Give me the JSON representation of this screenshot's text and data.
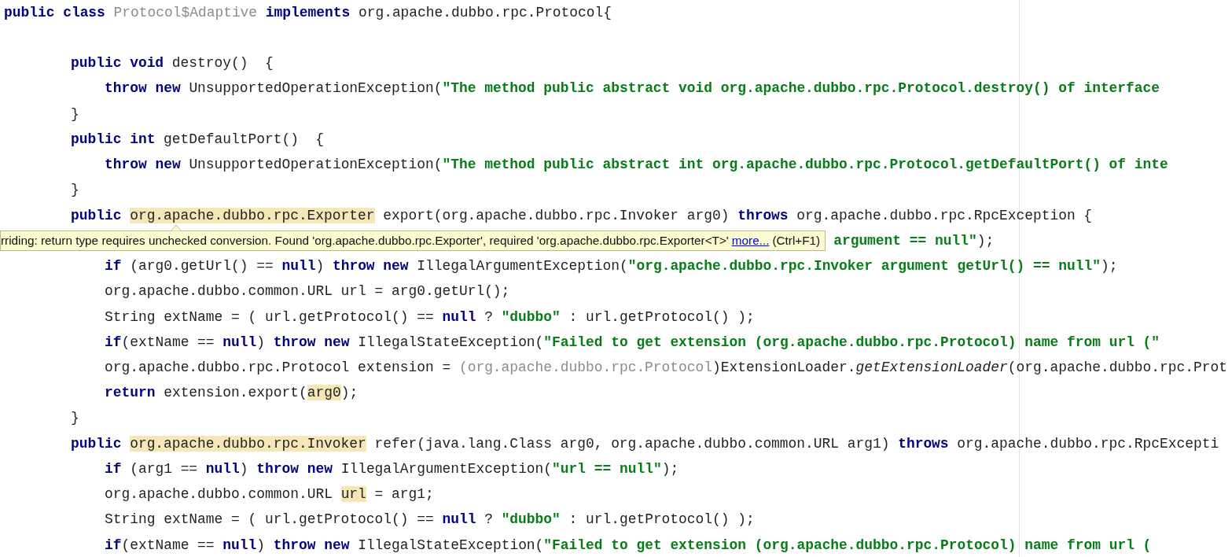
{
  "editor": {
    "lines": [
      {
        "segments": [
          {
            "kind": "keyword",
            "text": "public class "
          },
          {
            "kind": "muted",
            "text": "Protocol$Adaptive"
          },
          {
            "kind": "keyword",
            "text": " implements"
          },
          {
            "kind": "plain",
            "text": " org.apache.dubbo.rpc.Protocol{"
          }
        ],
        "children": [
          {
            "segments": [
              {
                "kind": "keyword",
                "text": "public void"
              },
              {
                "kind": "plain",
                "text": " destroy()  {"
              }
            ],
            "children": [
              {
                "segments": [
                  {
                    "kind": "keyword",
                    "text": "throw new"
                  },
                  {
                    "kind": "plain",
                    "text": " UnsupportedOperationException("
                  },
                  {
                    "kind": "string",
                    "text": "\"The method public abstract void org.apache.dubbo.rpc.Protocol.destroy() of interface"
                  }
                ]
              }
            ]
          },
          {
            "segments": [
              {
                "kind": "plain",
                "text": "}"
              }
            ]
          },
          {
            "segments": [
              {
                "kind": "keyword",
                "text": "public int"
              },
              {
                "kind": "plain",
                "text": " getDefaultPort()  {"
              }
            ],
            "children": [
              {
                "segments": [
                  {
                    "kind": "keyword",
                    "text": "throw new"
                  },
                  {
                    "kind": "plain",
                    "text": " UnsupportedOperationException("
                  },
                  {
                    "kind": "string",
                    "text": "\"The method public abstract int org.apache.dubbo.rpc.Protocol.getDefaultPort() of inte"
                  }
                ]
              }
            ]
          },
          {
            "segments": [
              {
                "kind": "plain",
                "text": "}"
              }
            ]
          },
          {
            "segments": [
              {
                "kind": "keyword",
                "text": "public "
              },
              {
                "kind": "plain",
                "text": "org.apache.dubbo.rpc.Exporter",
                "highlight": true
              },
              {
                "kind": "plain",
                "text": " export(org.apache.dubbo.rpc.Invoker arg0) "
              },
              {
                "kind": "keyword",
                "text": "throws"
              },
              {
                "kind": "plain",
                "text": " org.apache.dubbo.rpc.RpcException {"
              }
            ],
            "children": [
              {
                "tooltip": {
                  "text": "rriding: return type requires unchecked conversion. Found 'org.apache.dubbo.rpc.Exporter', required 'org.apache.dubbo.rpc.Exporter<T>'",
                  "link": "more...",
                  "shortcut": "(Ctrl+F1)"
                },
                "segments": [
                  {
                    "kind": "string",
                    "text": "argument == null\""
                  },
                  {
                    "kind": "plain",
                    "text": ");"
                  }
                ]
              },
              {
                "segments": [
                  {
                    "kind": "keyword",
                    "text": "if"
                  },
                  {
                    "kind": "plain",
                    "text": " (arg0.getUrl() == "
                  },
                  {
                    "kind": "keyword",
                    "text": "null"
                  },
                  {
                    "kind": "plain",
                    "text": ") "
                  },
                  {
                    "kind": "keyword",
                    "text": "throw new"
                  },
                  {
                    "kind": "plain",
                    "text": " IllegalArgumentException("
                  },
                  {
                    "kind": "string",
                    "text": "\"org.apache.dubbo.rpc.Invoker argument getUrl() == null\""
                  },
                  {
                    "kind": "plain",
                    "text": ");"
                  }
                ]
              },
              {
                "segments": [
                  {
                    "kind": "plain",
                    "text": "org.apache.dubbo.common.URL url = arg0.getUrl();"
                  }
                ]
              },
              {
                "segments": [
                  {
                    "kind": "plain",
                    "text": "String extName = ( url.getProtocol() == "
                  },
                  {
                    "kind": "keyword",
                    "text": "null"
                  },
                  {
                    "kind": "plain",
                    "text": " ? "
                  },
                  {
                    "kind": "string",
                    "text": "\"dubbo\""
                  },
                  {
                    "kind": "plain",
                    "text": " : url.getProtocol() );"
                  }
                ]
              },
              {
                "segments": [
                  {
                    "kind": "keyword",
                    "text": "if"
                  },
                  {
                    "kind": "plain",
                    "text": "(extName == "
                  },
                  {
                    "kind": "keyword",
                    "text": "null"
                  },
                  {
                    "kind": "plain",
                    "text": ") "
                  },
                  {
                    "kind": "keyword",
                    "text": "throw new"
                  },
                  {
                    "kind": "plain",
                    "text": " IllegalStateException("
                  },
                  {
                    "kind": "string",
                    "text": "\"Failed to get extension (org.apache.dubbo.rpc.Protocol) name from url (\""
                  }
                ]
              },
              {
                "segments": [
                  {
                    "kind": "plain",
                    "text": "org.apache.dubbo.rpc.Protocol extension = "
                  },
                  {
                    "kind": "muted",
                    "text": "(org.apache.dubbo.rpc.Protocol"
                  },
                  {
                    "kind": "plain",
                    "text": ")ExtensionLoader."
                  },
                  {
                    "kind": "italic",
                    "text": "getExtensionLoader"
                  },
                  {
                    "kind": "plain",
                    "text": "(org.apache.dubbo.rpc.Prot"
                  }
                ]
              },
              {
                "segments": [
                  {
                    "kind": "keyword",
                    "text": "return"
                  },
                  {
                    "kind": "plain",
                    "text": " extension.export("
                  },
                  {
                    "kind": "plain",
                    "text": "arg0",
                    "highlight": true
                  },
                  {
                    "kind": "plain",
                    "text": ");"
                  }
                ]
              }
            ]
          },
          {
            "segments": [
              {
                "kind": "plain",
                "text": "}"
              }
            ]
          },
          {
            "segments": [
              {
                "kind": "keyword",
                "text": "public "
              },
              {
                "kind": "plain",
                "text": "org.apache.dubbo.rpc.Invoker",
                "highlight": true
              },
              {
                "kind": "plain",
                "text": " refer(java.lang.Class arg0, org.apache.dubbo.common.URL arg1) "
              },
              {
                "kind": "keyword",
                "text": "throws"
              },
              {
                "kind": "plain",
                "text": " org.apache.dubbo.rpc.RpcExcepti"
              }
            ],
            "children": [
              {
                "segments": [
                  {
                    "kind": "keyword",
                    "text": "if"
                  },
                  {
                    "kind": "plain",
                    "text": " (arg1 == "
                  },
                  {
                    "kind": "keyword",
                    "text": "null"
                  },
                  {
                    "kind": "plain",
                    "text": ") "
                  },
                  {
                    "kind": "keyword",
                    "text": "throw new"
                  },
                  {
                    "kind": "plain",
                    "text": " IllegalArgumentException("
                  },
                  {
                    "kind": "string",
                    "text": "\"url == null\""
                  },
                  {
                    "kind": "plain",
                    "text": ");"
                  }
                ]
              },
              {
                "segments": [
                  {
                    "kind": "plain",
                    "text": "org.apache.dubbo.common.URL "
                  },
                  {
                    "kind": "plain",
                    "text": "url",
                    "highlight": true
                  },
                  {
                    "kind": "plain",
                    "text": " = arg1;"
                  }
                ]
              },
              {
                "segments": [
                  {
                    "kind": "plain",
                    "text": "String extName = ( url.getProtocol() == "
                  },
                  {
                    "kind": "keyword",
                    "text": "null"
                  },
                  {
                    "kind": "plain",
                    "text": " ? "
                  },
                  {
                    "kind": "string",
                    "text": "\"dubbo\""
                  },
                  {
                    "kind": "plain",
                    "text": " : url.getProtocol() );"
                  }
                ]
              },
              {
                "segments": [
                  {
                    "kind": "keyword",
                    "text": "if"
                  },
                  {
                    "kind": "plain",
                    "text": "(extName == "
                  },
                  {
                    "kind": "keyword",
                    "text": "null"
                  },
                  {
                    "kind": "plain",
                    "text": ") "
                  },
                  {
                    "kind": "keyword",
                    "text": "throw new"
                  },
                  {
                    "kind": "plain",
                    "text": " IllegalStateException("
                  },
                  {
                    "kind": "string",
                    "text": "\"Failed to get extension (org.apache.dubbo.rpc.Protocol) name from url ("
                  }
                ]
              }
            ]
          }
        ]
      }
    ]
  }
}
